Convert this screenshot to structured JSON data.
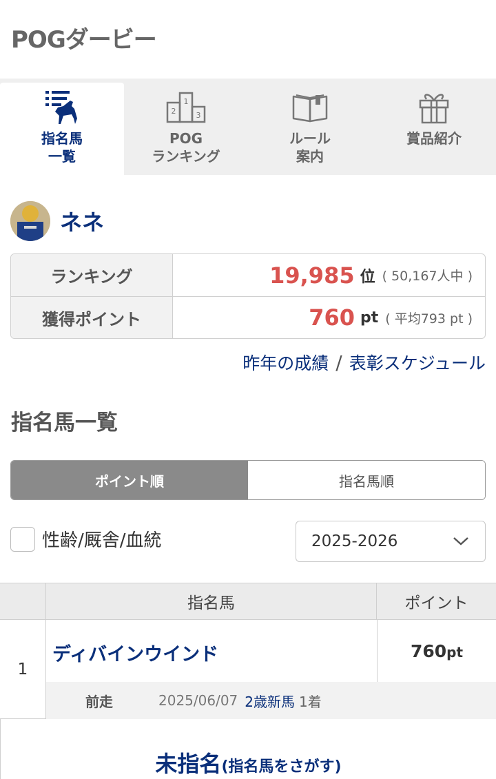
{
  "app": {
    "title": "POGダービー"
  },
  "tabs": [
    {
      "label": "指名馬\n一覧",
      "icon": "horse-list-icon",
      "active": true
    },
    {
      "label": "POG\nランキング",
      "icon": "podium-icon",
      "active": false
    },
    {
      "label": "ルール\n案内",
      "icon": "book-icon",
      "active": false
    },
    {
      "label": "賞品紹介",
      "icon": "gift-icon",
      "active": false
    }
  ],
  "profile": {
    "username": "ネネ"
  },
  "stats": {
    "ranking_label": "ランキング",
    "ranking_value": "19,985",
    "ranking_unit": "位",
    "ranking_total": "( 50,167人中 )",
    "points_label": "獲得ポイント",
    "points_value": "760",
    "points_unit": "pt",
    "points_avg": "( 平均793 pt )"
  },
  "links": {
    "last_year": "昨年の成績",
    "separator": "/",
    "schedule": "表彰スケジュール"
  },
  "section": {
    "title": "指名馬一覧"
  },
  "sort": {
    "by_points": "ポイント順",
    "by_pick": "指名馬順",
    "active": "by_points"
  },
  "filter": {
    "label": "性齢/厩舎/血統",
    "checked": false,
    "season": "2025-2026"
  },
  "table": {
    "headers": {
      "name": "指名馬",
      "points": "ポイント"
    },
    "rows": [
      {
        "rank": "1",
        "name": "ディバインウインド",
        "points": "760",
        "points_unit": "pt",
        "last_label": "前走",
        "last_date": "2025/06/07",
        "last_race": "2歳新馬",
        "last_result": "1着"
      }
    ],
    "empty": {
      "main": "未指名",
      "sub": "(指名馬をさがす)"
    }
  },
  "colors": {
    "brand_navy": "#0a2f7a",
    "accent_red": "#d9534f",
    "tab_bg": "#efefef"
  }
}
